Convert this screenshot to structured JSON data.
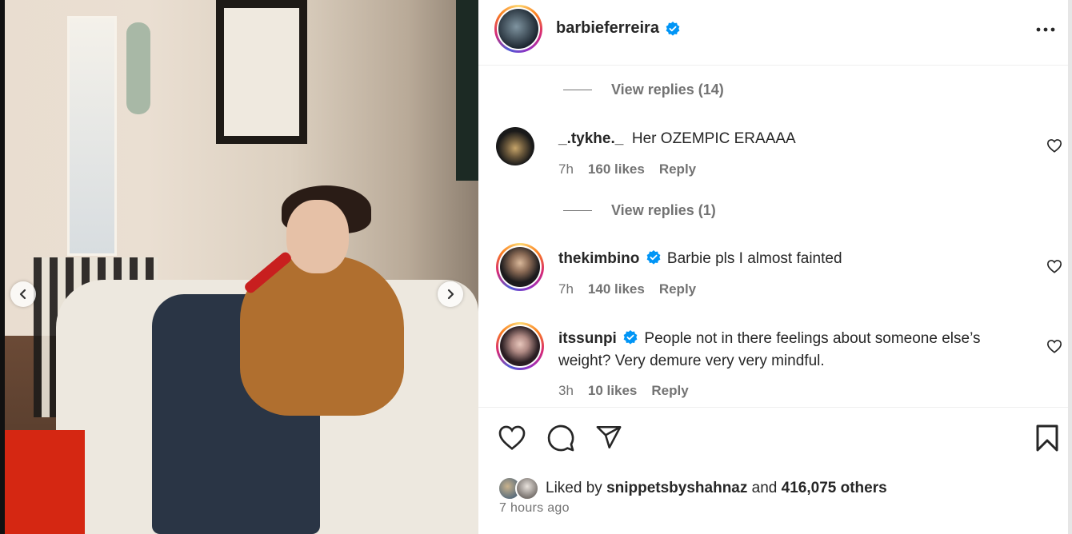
{
  "post": {
    "username": "barbieferreira",
    "verified": true
  },
  "comments_thread": [
    {
      "type": "view_replies",
      "label": "View replies (14)"
    },
    {
      "type": "comment",
      "username": "_.tykhe._",
      "verified": false,
      "text": "Her OZEMPIC ERAAAA",
      "time": "7h",
      "likes": "160 likes",
      "reply": "Reply"
    },
    {
      "type": "view_replies",
      "label": "View replies (1)"
    },
    {
      "type": "comment",
      "username": "thekimbino",
      "verified": true,
      "text": "Barbie pls I almost fainted",
      "time": "7h",
      "likes": "140 likes",
      "reply": "Reply"
    },
    {
      "type": "comment",
      "username": "itssunpi",
      "verified": true,
      "text": "People not in there feelings about someone else’s weight? Very demure very very mindful.",
      "time": "3h",
      "likes": "10 likes",
      "reply": "Reply"
    }
  ],
  "liked_by": {
    "prefix": "Liked by",
    "user": "snippetsbyshahnaz",
    "conj": "and",
    "others": "416,075 others"
  },
  "timestamp": "7 hours ago",
  "icons": [
    "chevron-left-icon",
    "chevron-right-icon",
    "verified-badge-icon",
    "more-options-icon",
    "heart-icon",
    "comment-icon",
    "share-icon",
    "bookmark-icon"
  ],
  "colors": {
    "verified": "#0095f6",
    "text": "#262626",
    "secondary": "#737373",
    "border": "#efefef"
  }
}
